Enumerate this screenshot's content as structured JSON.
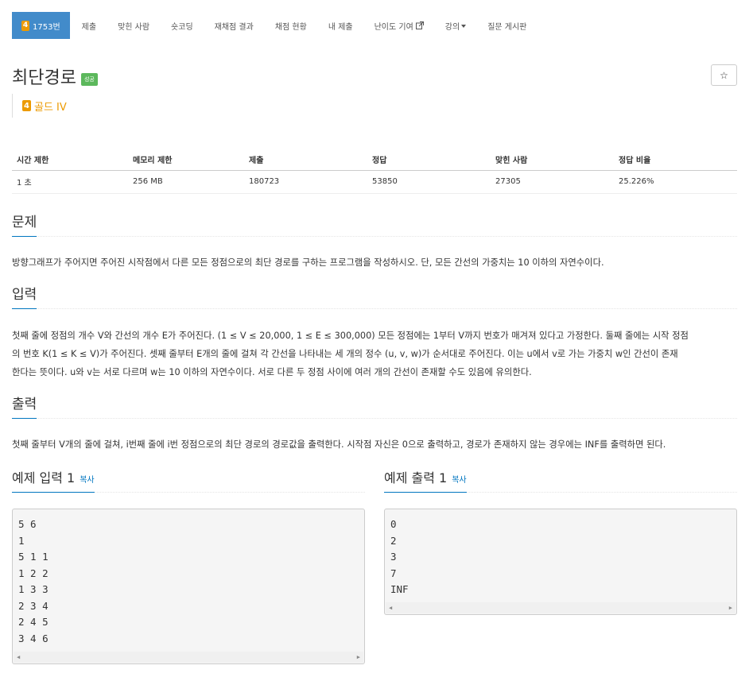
{
  "nav": {
    "problem_number": "1753번",
    "tier_digit": "4",
    "items": [
      "제출",
      "맞힌 사람",
      "숏코딩",
      "재채점 결과",
      "채점 현황",
      "내 제출",
      "난이도 기여",
      "강의",
      "질문 게시판"
    ]
  },
  "problem": {
    "title": "최단경로",
    "status_badge": "성공",
    "star": "☆",
    "tier_digit": "4",
    "tier_label": "골드 IV"
  },
  "stats": {
    "headers": [
      "시간 제한",
      "메모리 제한",
      "제출",
      "정답",
      "맞힌 사람",
      "정답 비율"
    ],
    "values": [
      "1 초",
      "256 MB",
      "180723",
      "53850",
      "27305",
      "25.226%"
    ]
  },
  "sections": {
    "problem_title": "문제",
    "problem_text": "방향그래프가 주어지면 주어진 시작점에서 다른 모든 정점으로의 최단 경로를 구하는 프로그램을 작성하시오. 단, 모든 간선의 가중치는 10 이하의 자연수이다.",
    "input_title": "입력",
    "input_lines": [
      "첫째 줄에 정점의 개수 V와 간선의 개수 E가 주어진다. (1 ≤ V ≤ 20,000, 1 ≤ E ≤ 300,000) 모든 정점에는 1부터 V까지 번호가 매겨져 있다고 가정한다. 둘째 줄에는 시작 정점",
      "의 번호 K(1 ≤ K ≤ V)가 주어진다. 셋째 줄부터 E개의 줄에 걸쳐 각 간선을 나타내는 세 개의 정수 (u, v, w)가 순서대로 주어진다. 이는 u에서 v로 가는 가중치 w인 간선이 존재",
      "한다는 뜻이다. u와 v는 서로 다르며 w는 10 이하의 자연수이다. 서로 다른 두 정점 사이에 여러 개의 간선이 존재할 수도 있음에 유의한다."
    ],
    "output_title": "출력",
    "output_text": "첫째 줄부터 V개의 줄에 걸쳐, i번째 줄에 i번 정점으로의 최단 경로의 경로값을 출력한다. 시작점 자신은 0으로 출력하고, 경로가 존재하지 않는 경우에는 INF를 출력하면 된다."
  },
  "samples": {
    "input_title": "예제 입력 1",
    "output_title": "예제 출력 1",
    "copy_label": "복사",
    "input_lines": [
      "5 6",
      "1",
      "5 1 1",
      "1 2 2",
      "1 3 3",
      "2 3 4",
      "2 4 5",
      "3 4 6"
    ],
    "output_lines": [
      "0",
      "2",
      "3",
      "7",
      "INF"
    ]
  },
  "colors": {
    "nav_active": "#428bca",
    "tier_gold": "#ec9a00",
    "success": "#5cb85c",
    "link": "#0076c0"
  }
}
